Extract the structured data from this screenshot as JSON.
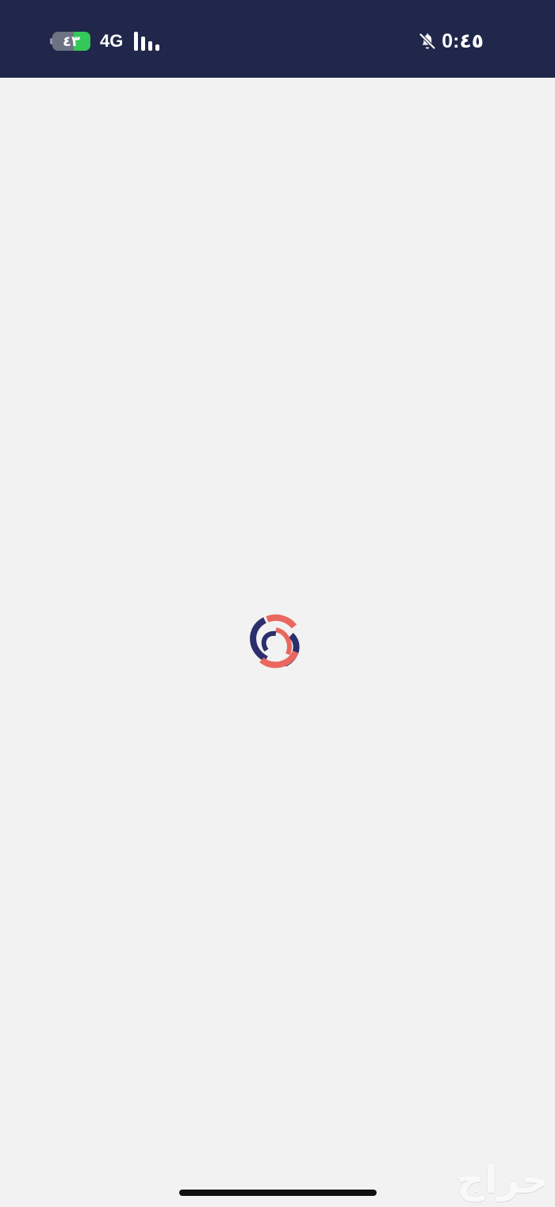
{
  "status_bar": {
    "battery_text": "٤٣",
    "battery_level_percent": 43,
    "network": "4G",
    "time": "0:٤٥",
    "icons": {
      "battery": "battery-charging-icon",
      "signal": "cellular-signal-icon",
      "notification": "bell-slash-icon"
    },
    "colors": {
      "background": "#20274a",
      "battery_fill": "#34c759",
      "text": "#ffffff"
    }
  },
  "main": {
    "background_color": "#f2f2f2",
    "loading": {
      "icon": "loading-spinner-icon",
      "colors": {
        "primary": "#2b2f6b",
        "accent": "#e9675e"
      }
    }
  },
  "watermark": {
    "text": "حراج"
  }
}
